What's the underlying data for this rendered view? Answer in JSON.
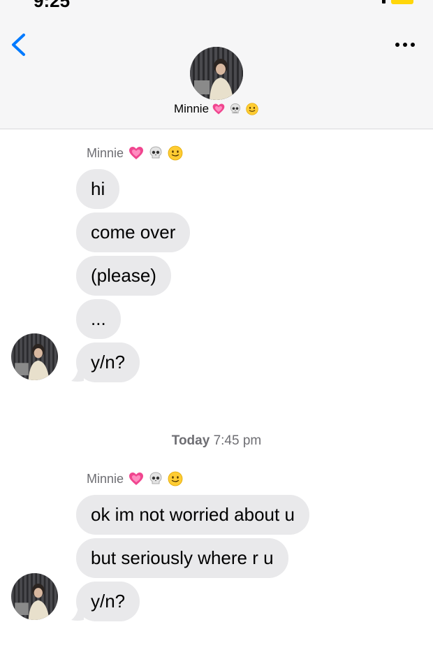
{
  "status": {
    "time": "9:25"
  },
  "header": {
    "contact_name": "Minnie",
    "emojis": [
      "heart-emoji-icon",
      "skull-emoji-icon",
      "smile-emoji-icon"
    ]
  },
  "colors": {
    "accent": "#007aff",
    "bubble_incoming": "#e9e9eb",
    "secondary_text": "#6e6e73",
    "header_bg": "#f6f6f7"
  },
  "groups": [
    {
      "sender": "Minnie",
      "messages": [
        "hi",
        "come over",
        "(please)",
        "...",
        "y/n?"
      ]
    },
    {
      "sender": "Minnie",
      "messages": [
        "ok im not worried about u",
        "but seriously where r u",
        "y/n?"
      ]
    }
  ],
  "timestamp": {
    "day": "Today",
    "time": "7:45 pm"
  }
}
